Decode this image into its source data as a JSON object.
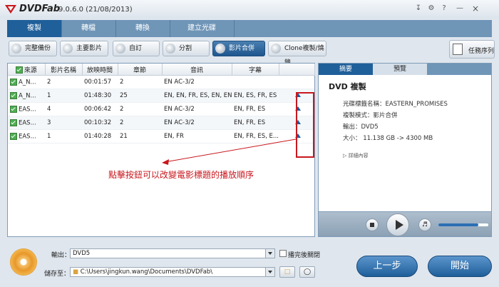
{
  "app": {
    "name": "DVDFab",
    "version": "9.0.6.0 (21/08/2013)"
  },
  "main_tabs": [
    {
      "label": "複製"
    },
    {
      "label": "轉檔"
    },
    {
      "label": "轉換"
    },
    {
      "label": "建立光碟"
    }
  ],
  "modes": [
    {
      "label": "完整備份"
    },
    {
      "label": "主要影片"
    },
    {
      "label": "自訂"
    },
    {
      "label": "分割"
    },
    {
      "label": "影片合併"
    },
    {
      "label": "Clone複製/燒錄"
    }
  ],
  "task_queue_label": "任務序列",
  "table": {
    "headers": [
      "來源",
      "影片名稱",
      "放映時間",
      "章節",
      "音訊",
      "字幕"
    ],
    "rows": [
      {
        "source": "A_N...",
        "title": "2",
        "runtime": "00:01:57",
        "chapters": "2",
        "audio": "EN AC-3/2",
        "subtitles": ""
      },
      {
        "source": "A_N...",
        "title": "1",
        "runtime": "01:48:30",
        "chapters": "25",
        "audio": "EN, EN, FR, ES, EN, EN",
        "subtitles": "EN, ES, FR, ES"
      },
      {
        "source": "EAS...",
        "title": "4",
        "runtime": "00:06:42",
        "chapters": "2",
        "audio": "EN AC-3/2",
        "subtitles": "EN, FR, ES"
      },
      {
        "source": "EAS...",
        "title": "3",
        "runtime": "00:10:32",
        "chapters": "2",
        "audio": "EN AC-3/2",
        "subtitles": "EN, FR, ES"
      },
      {
        "source": "EAS...",
        "title": "1",
        "runtime": "01:40:28",
        "chapters": "21",
        "audio": "EN, FR",
        "subtitles": "EN, FR, ES, E..."
      }
    ]
  },
  "annotation": "點擊按鈕可以改變電影標題的播放順序",
  "right_tabs": [
    {
      "label": "摘要"
    },
    {
      "label": "預覽"
    }
  ],
  "summary": {
    "title": "DVD 複製",
    "disc_label": "光碟標籤名稱：EASTERN_PROMISES",
    "copy_mode": "複製模式：影片合併",
    "output": "輸出：DVD5",
    "size": "大小：  11.138 GB -> 4300 MB",
    "details_link": "▷ 詳細內容"
  },
  "player": {
    "progress": 0.0,
    "volume": 0.8
  },
  "output": {
    "label": "輸出：",
    "value": "DVD5",
    "checkbox_label": "播完後關閉",
    "save_label": "儲存至：",
    "save_path": "C:\\Users\\jingkun.wang\\Documents\\DVDFab\\"
  },
  "buttons": {
    "back": "上一步",
    "start": "開始"
  }
}
